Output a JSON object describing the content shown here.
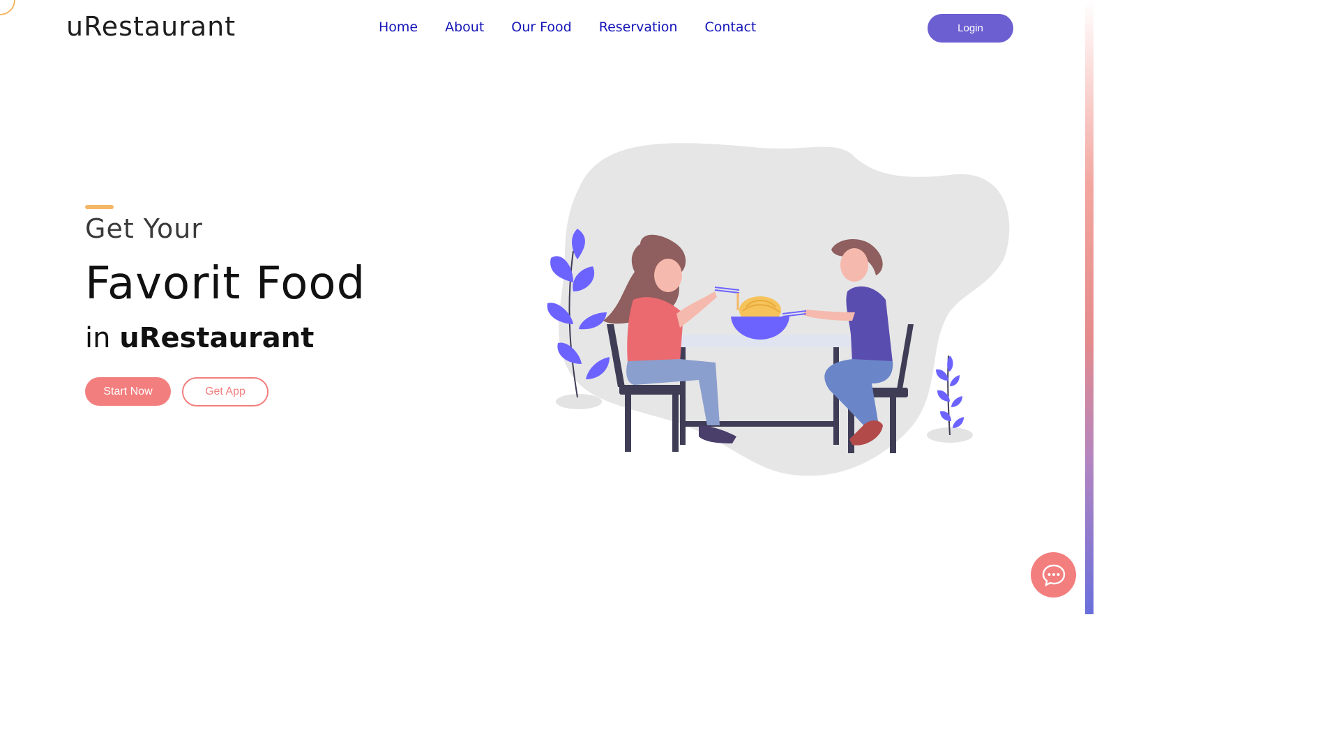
{
  "header": {
    "logo": "uRestaurant",
    "nav": [
      "Home",
      "About",
      "Our Food",
      "Reservation",
      "Contact"
    ],
    "login_label": "Login"
  },
  "hero": {
    "line1": "Get Your",
    "line2": "Favorit Food",
    "line3_prefix": "in",
    "line3_brand": "uRestaurant",
    "start_label": "Start Now",
    "app_label": "Get App"
  },
  "icons": {
    "chat": "chat-bubble-icon"
  },
  "colors": {
    "accent_purple": "#6c5fd1",
    "accent_coral": "#f37e7e",
    "accent_orange": "#f5b766",
    "nav_blue": "#1414b8"
  }
}
